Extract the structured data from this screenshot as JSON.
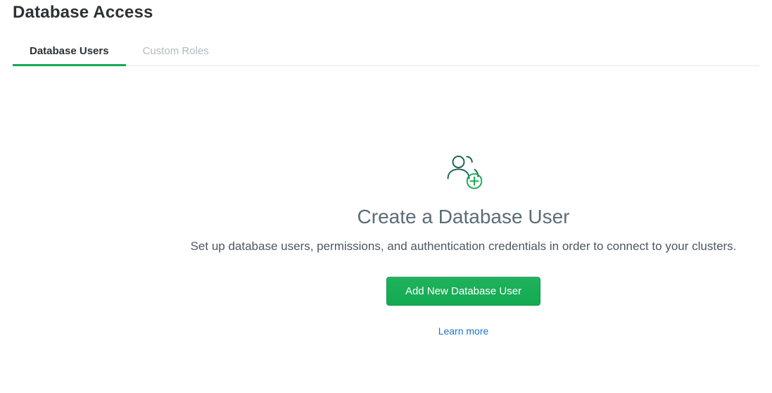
{
  "page": {
    "title": "Database Access"
  },
  "tabs": {
    "items": [
      {
        "label": "Database Users",
        "active": true
      },
      {
        "label": "Custom Roles",
        "active": false
      }
    ]
  },
  "empty": {
    "title": "Create a Database User",
    "description": "Set up database users, permissions, and authentication credentials in order to connect to your clusters.",
    "primary_btn": "Add New Database User",
    "learn_more": "Learn more"
  },
  "colors": {
    "accent": "#13aa52",
    "link": "#1a74d2"
  }
}
